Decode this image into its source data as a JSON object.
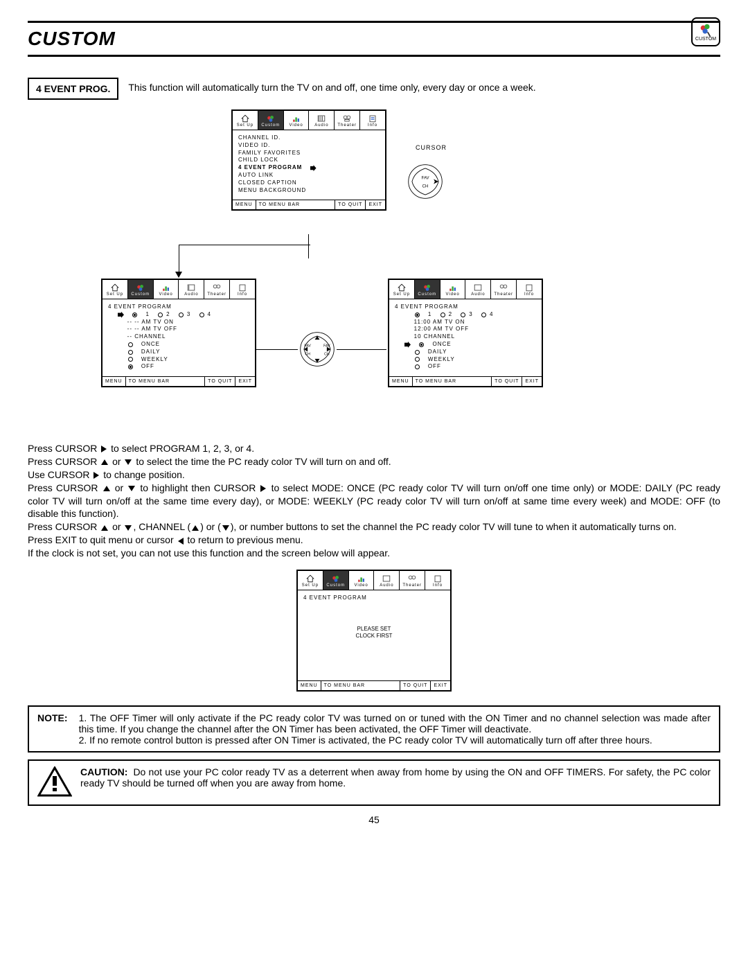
{
  "header": {
    "title": "CUSTOM",
    "cornerLabel": "CUSTOM"
  },
  "section": {
    "label": "4 EVENT PROG.",
    "desc": "This function will automatically turn the TV on and off, one time only, every day or once a week."
  },
  "tabs": [
    "Set Up",
    "Custom",
    "Video",
    "Audio",
    "Theater",
    "Info"
  ],
  "topMenu": {
    "items": [
      "CHANNEL ID.",
      "VIDEO ID.",
      "FAMILY FAVORITES",
      "CHILD LOCK",
      "4 EVENT PROGRAM",
      "AUTO LINK",
      "CLOSED CAPTION",
      "MENU BACKGROUND"
    ],
    "highlightIndex": 4
  },
  "cursorLabel": "CURSOR",
  "favch": {
    "top": "FAV",
    "bottom": "CH"
  },
  "leftMenu": {
    "title": "4 EVENT PROGRAM",
    "progNums": [
      "1",
      "2",
      "3",
      "4"
    ],
    "tvon": "-- -- AM TV ON",
    "tvoff": "-- -- AM TV OFF",
    "channel": "-- CHANNEL",
    "modes": [
      "ONCE",
      "DAILY",
      "WEEKLY",
      "OFF"
    ]
  },
  "rightMenu": {
    "title": "4 EVENT PROGRAM",
    "progNums": [
      "1",
      "2",
      "3",
      "4"
    ],
    "tvon": "11:00 AM TV ON",
    "tvoff": "12:00 AM TV OFF",
    "channel": "10 CHANNEL",
    "modes": [
      "ONCE",
      "DAILY",
      "WEEKLY",
      "OFF"
    ]
  },
  "footer": {
    "c1": "MENU",
    "c2": "TO MENU BAR",
    "c3": "TO QUIT",
    "c4": "EXIT"
  },
  "instructions": {
    "l1a": "Press CURSOR ",
    "l1b": " to select PROGRAM 1, 2, 3, or 4.",
    "l2a": "Press CURSOR ",
    "l2b": " or ",
    "l2c": " to select the time the PC ready color TV will turn on and off.",
    "l3a": "Use CURSOR ",
    "l3b": " to change position.",
    "l4a": "Press CURSOR ",
    "l4b": " or ",
    "l4c": " to highlight then CURSOR ",
    "l4d": " to select MODE: ONCE (PC ready color TV will turn on/off one time only) or MODE: DAILY (PC ready color TV will turn on/off at the same time every day), or MODE: WEEKLY (PC ready color TV will turn on/off at same time every week) and MODE: OFF (to disable this function).",
    "l5a": "Press CURSOR ",
    "l5b": " or ",
    "l5c": ", CHANNEL (",
    "l5d": ") or (",
    "l5e": "), or number buttons to set the channel the PC ready color TV will tune to when it automatically turns on.",
    "l6a": "Press EXIT to quit menu or cursor ",
    "l6b": " to return to previous menu.",
    "l7": "If the clock is not set, you can not use this function and the screen below will appear."
  },
  "clockMenu": {
    "title": "4 EVENT PROGRAM",
    "msg1": "PLEASE SET",
    "msg2": "CLOCK FIRST"
  },
  "note": {
    "label": "NOTE:",
    "p1": "1. The OFF Timer will only activate if the PC ready color TV was turned on or tuned with the ON Timer and no channel selection was made after this time.  If you change the channel after the ON Timer has been activated, the OFF Timer will deactivate.",
    "p2": "2. If no remote control button is pressed after ON Timer is activated, the PC ready color TV will automatically turn off after three hours."
  },
  "caution": {
    "label": "CAUTION:",
    "text": "Do not use your PC color ready TV as a deterrent when away from home by using the ON and OFF TIMERS.  For safety, the PC color ready TV should be turned off when you are away from home."
  },
  "pageNumber": "45"
}
